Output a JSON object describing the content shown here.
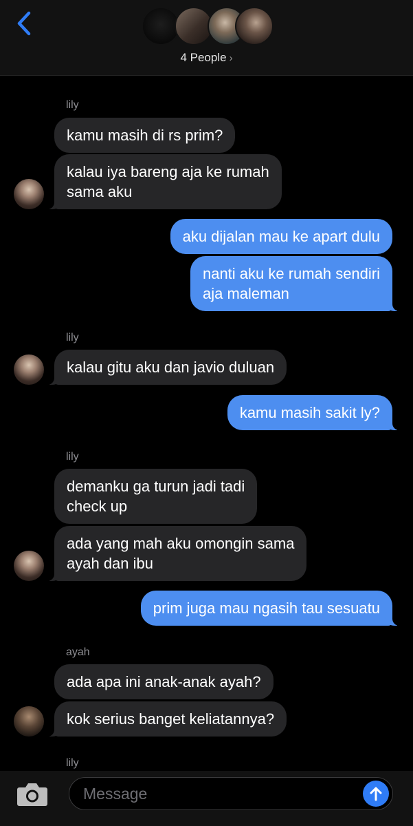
{
  "header": {
    "people_label": "4 People",
    "chevron": "›",
    "back_icon": "chevron-left-icon",
    "accent_color": "#2f7cf6"
  },
  "messages": [
    {
      "sender": "lily"
    },
    {
      "text": "kamu masih di rs prim?"
    },
    {
      "text": "kalau iya bareng aja ke rumah\nsama aku"
    },
    {
      "text": "aku dijalan mau ke apart dulu"
    },
    {
      "text": "nanti aku ke rumah sendiri\naja maleman"
    },
    {
      "sender": "lily"
    },
    {
      "text": "kalau gitu aku dan javio duluan"
    },
    {
      "text": "kamu masih sakit ly?"
    },
    {
      "sender": "lily"
    },
    {
      "text": "demanku ga turun jadi tadi\ncheck up"
    },
    {
      "text": "ada yang mah aku omongin sama\nayah dan ibu"
    },
    {
      "text": "prim juga mau ngasih tau sesuatu"
    },
    {
      "sender": "ayah"
    },
    {
      "text": "ada apa ini anak-anak ayah?"
    },
    {
      "text": "kok serius banget keliatannya?"
    },
    {
      "sender": "lily"
    }
  ],
  "composer": {
    "placeholder": "Message",
    "camera_icon": "camera-icon",
    "send_icon": "arrow-up-icon"
  },
  "colors": {
    "incoming_bubble": "#262628",
    "outgoing_bubble": "#4d8ef0",
    "background": "#000000"
  }
}
